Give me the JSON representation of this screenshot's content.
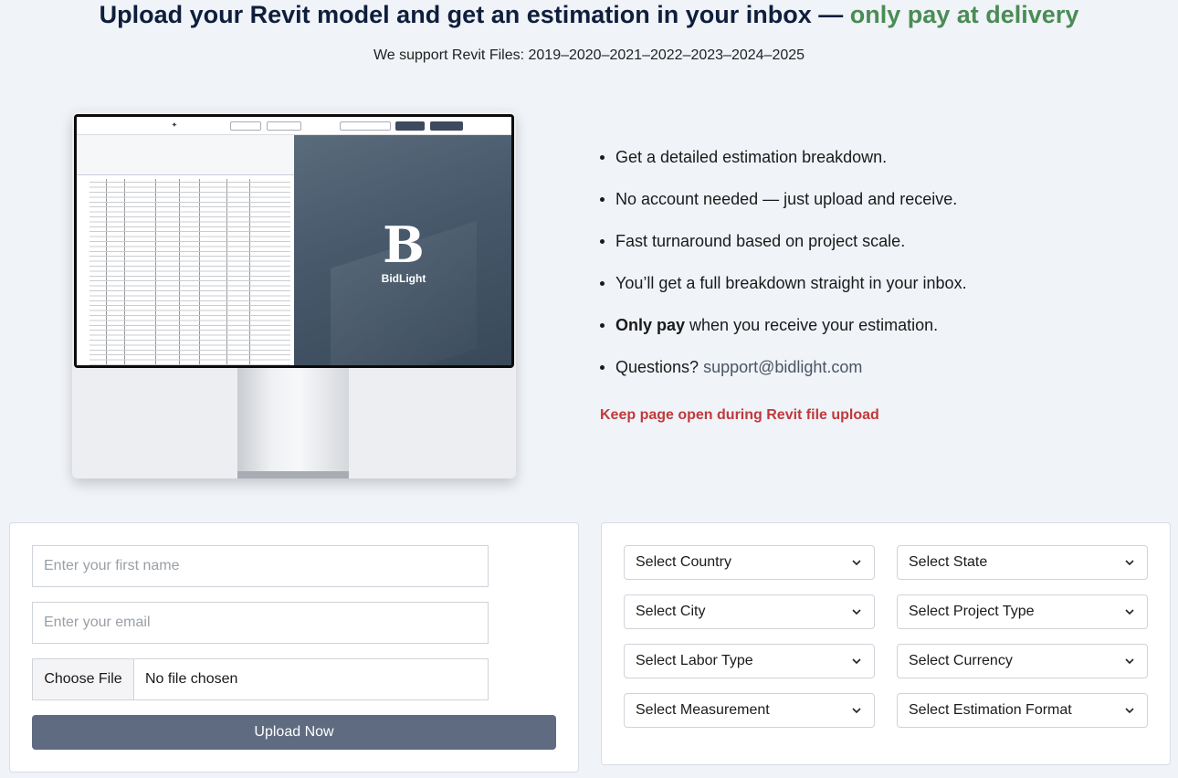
{
  "header": {
    "title_main": "Upload your Revit model and get an estimation in your inbox — ",
    "title_accent": "only pay at delivery",
    "subtitle": "We support Revit Files: 2019–2020–2021–2022–2023–2024–2025"
  },
  "preview": {
    "brand_letter": "B",
    "brand_name": "BidLight"
  },
  "features": {
    "items": [
      "Get a detailed estimation breakdown.",
      "No account needed — just upload and receive.",
      "Fast turnaround based on project scale.",
      "You’ll get a full breakdown straight in your inbox."
    ],
    "pay_bold": "Only pay",
    "pay_rest": " when you receive your estimation.",
    "questions_label": "Questions? ",
    "support_email": "support@bidlight.com"
  },
  "warning": "Keep page open during Revit file upload",
  "form": {
    "first_name_placeholder": "Enter your first name",
    "email_placeholder": "Enter your email",
    "file_button": "Choose File",
    "file_status": "No file chosen",
    "submit_label": "Upload Now"
  },
  "selects": {
    "country": "Select Country",
    "state": "Select State",
    "city": "Select City",
    "project_type": "Select Project Type",
    "labor_type": "Select Labor Type",
    "currency": "Select Currency",
    "measurement": "Select Measurement",
    "estimation_format": "Select Estimation Format"
  },
  "colors": {
    "accent_green": "#4a8c55",
    "warning_red": "#c0393b",
    "button_slate": "#5f6b80",
    "title_navy": "#0f1e3c"
  }
}
